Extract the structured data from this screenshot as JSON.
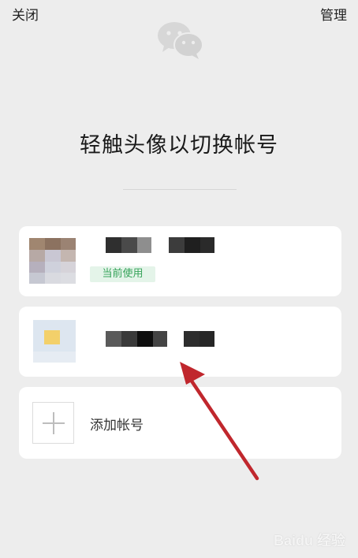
{
  "topbar": {
    "close_label": "关闭",
    "manage_label": "管理"
  },
  "page_title": "轻触头像以切换帐号",
  "accounts": [
    {
      "badge_label": "当前使用"
    },
    {}
  ],
  "add_account_label": "添加帐号",
  "watermark": "Baidu 经验",
  "colors": {
    "background": "#ededed",
    "card": "#ffffff",
    "badge_bg": "#e4f4e9",
    "badge_text": "#36a35a",
    "arrow": "#c0272d"
  }
}
